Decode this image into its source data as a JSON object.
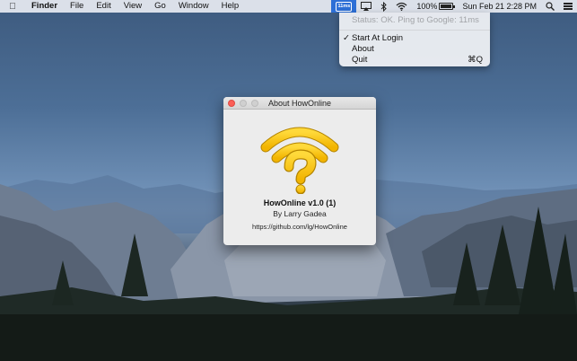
{
  "menubar": {
    "app_name": "Finder",
    "menus": [
      "File",
      "Edit",
      "View",
      "Go",
      "Window",
      "Help"
    ],
    "status": {
      "howonline_icon_label": "11ms",
      "battery_percent": "100%",
      "clock": "Sun Feb 21  2:28 PM"
    }
  },
  "dropdown": {
    "status_line": "Status: OK. Ping to Google: 11ms",
    "start_at_login": "Start At Login",
    "start_at_login_checked": true,
    "about": "About",
    "quit": "Quit",
    "quit_shortcut": "⌘Q"
  },
  "about_window": {
    "title": "About HowOnline",
    "app_name": "HowOnline v1.0 (1)",
    "author": "By Larry Gadea",
    "url": "https://github.com/lg/HowOnline"
  },
  "colors": {
    "menu_highlight": "#2d6fd6",
    "icon_yellow": "#f7c61a",
    "close_button": "#fc5f57"
  }
}
